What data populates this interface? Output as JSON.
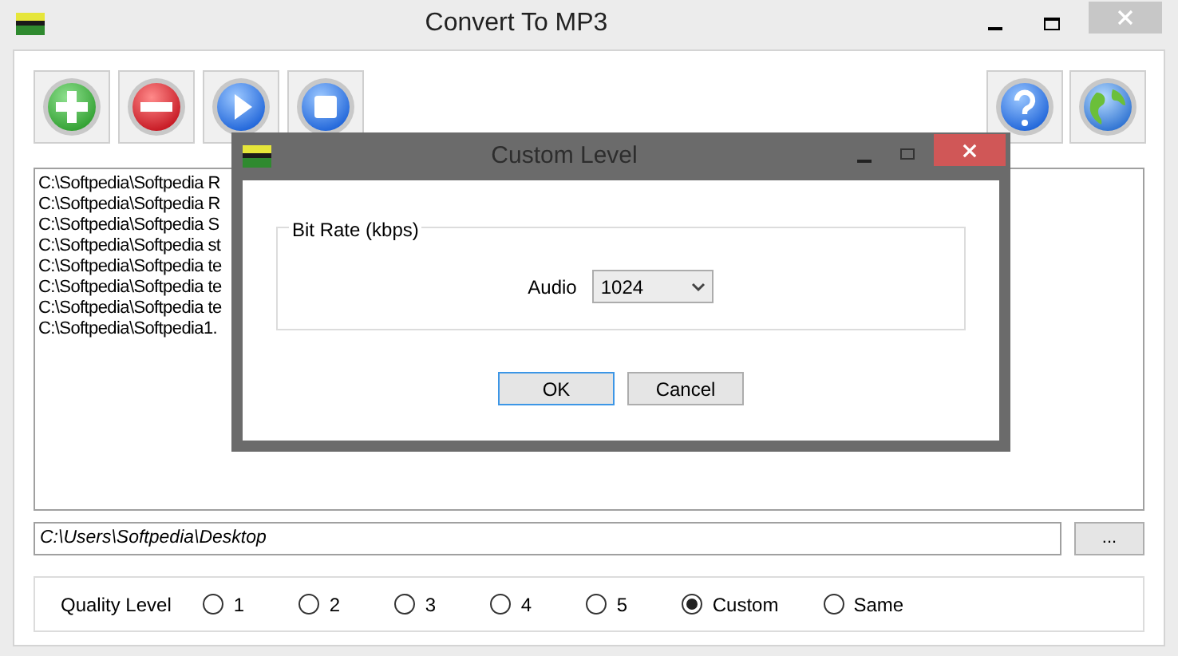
{
  "window": {
    "title": "Convert To MP3"
  },
  "toolbar": {
    "left": [
      {
        "kind": "add"
      },
      {
        "kind": "remove"
      },
      {
        "kind": "play"
      },
      {
        "kind": "stop"
      }
    ],
    "right": [
      {
        "kind": "help"
      },
      {
        "kind": "web"
      }
    ]
  },
  "file_list": [
    "C:\\Softpedia\\Softpedia R",
    "C:\\Softpedia\\Softpedia R",
    "C:\\Softpedia\\Softpedia S",
    "C:\\Softpedia\\Softpedia st",
    "C:\\Softpedia\\Softpedia te",
    "C:\\Softpedia\\Softpedia te",
    "C:\\Softpedia\\Softpedia te",
    "C:\\Softpedia\\Softpedia1."
  ],
  "output_path": {
    "value": "C:\\Users\\Softpedia\\Desktop",
    "browse": "..."
  },
  "quality": {
    "label": "Quality Level",
    "options": [
      {
        "label": "1",
        "selected": false
      },
      {
        "label": "2",
        "selected": false
      },
      {
        "label": "3",
        "selected": false
      },
      {
        "label": "4",
        "selected": false
      },
      {
        "label": "5",
        "selected": false
      },
      {
        "label": "Custom",
        "selected": true
      },
      {
        "label": "Same",
        "selected": false
      }
    ]
  },
  "dialog": {
    "title": "Custom Level",
    "group": "Bit Rate (kbps)",
    "audio_label": "Audio",
    "audio_value": "1024",
    "buttons": [
      {
        "label": "OK",
        "selected": true
      },
      {
        "label": "Cancel",
        "selected": false
      }
    ]
  }
}
